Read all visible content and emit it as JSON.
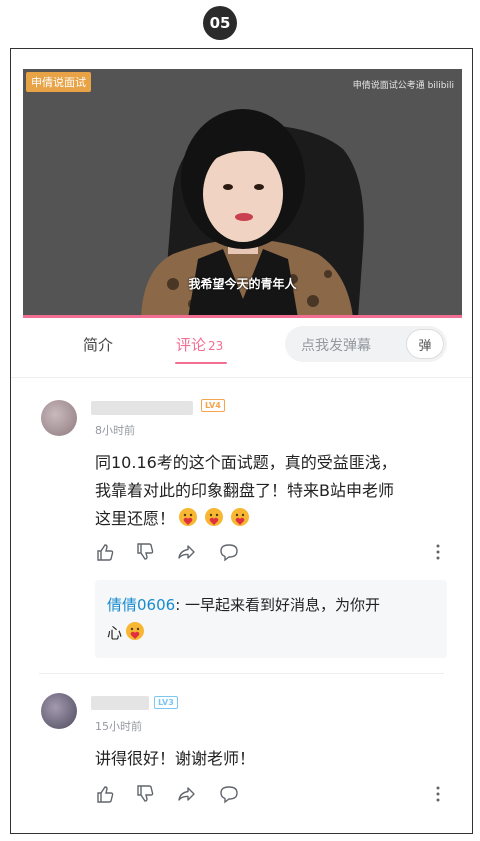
{
  "step_badge": "05",
  "video": {
    "channel_tag": "申倩说面试",
    "watermark": "申倩说面试公考通 bilibili",
    "subtitle": "我希望今天的青年人",
    "progress": 1.0
  },
  "tabs": {
    "intro_label": "简介",
    "comments_label": "评论",
    "comments_count": "23",
    "danmaku_placeholder": "点我发弹幕",
    "danmaku_button": "弹"
  },
  "comments": [
    {
      "level": "LV4",
      "time": "8小时前",
      "text_lines": [
        "同10.16考的这个面试题，真的受益匪浅，",
        "我靠着对此的印象翻盘了！特来B站申老师",
        "这里还愿！"
      ]
    },
    {
      "level": "LV3",
      "time": "15小时前",
      "text_lines": [
        "讲得很好！谢谢老师！"
      ]
    }
  ],
  "reply": {
    "author": "倩倩0606",
    "text_line1": ": 一早起来看到好消息，为你开",
    "text_line2": "心"
  },
  "icons": [
    "like-icon",
    "dislike-icon",
    "share-icon",
    "reply-icon",
    "more-icon",
    "emoji-icon"
  ],
  "colors": {
    "accent": "#f26e93",
    "link": "#178bcf"
  }
}
